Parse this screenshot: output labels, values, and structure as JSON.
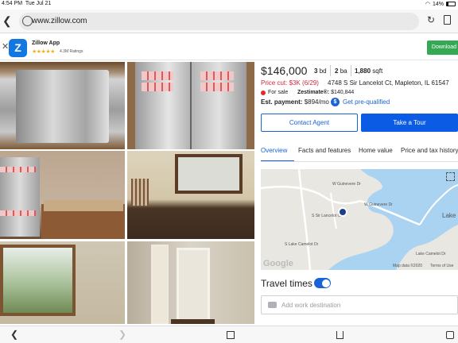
{
  "status_bar": {
    "time": "4:54 PM",
    "date": "Tue Jul 21",
    "battery": "14%"
  },
  "browser": {
    "url": "www.zillow.com",
    "icons": [
      "back-icon",
      "globe-icon",
      "reload-icon",
      "bookmark-icon"
    ]
  },
  "banner": {
    "app_name": "Zillow App",
    "stars": "★★★★★",
    "ratings": "4.3M Ratings",
    "download_label": "Download",
    "download_color": "#34a853",
    "logo_letter": "Z"
  },
  "listing": {
    "price": "$146,000",
    "beds": "3",
    "beds_label": "bd",
    "baths": "2",
    "baths_label": "ba",
    "sqft": "1,880",
    "sqft_label": "sqft",
    "price_cut": "Price cut: $3K (6/29)",
    "address": "4748 S Sir Lancelot Ct, Mapleton, IL 61547",
    "status": "For sale",
    "zestimate_label": "Zestimate®:",
    "zestimate": "$140,844",
    "est_payment_label": "Est. payment:",
    "est_payment": "$894/mo",
    "prequal": "Get pre-qualified",
    "status_color": "#e02b2b",
    "accent_color": "#1a62d8"
  },
  "actions": {
    "contact": "Contact Agent",
    "tour": "Take a Tour"
  },
  "tabs": [
    "Overview",
    "Facts and features",
    "Home value",
    "Price and tax history"
  ],
  "map": {
    "streets": [
      "W Guinevere Dr",
      "W Guinevere Dr",
      "S Sir Lancelot Ct",
      "S Lake Camelot Dr",
      "Lake Camelot Dr"
    ],
    "lake_label": "Lake",
    "data_label": "Map data ©2020",
    "terms_label": "Terms of Use",
    "google_label": "Google"
  },
  "travel": {
    "title": "Travel times",
    "toggle_on": true,
    "placeholder": "Add work destination"
  },
  "toolbar_icons": [
    "back-icon",
    "forward-icon",
    "home-icon",
    "share-icon",
    "tabs-icon"
  ]
}
